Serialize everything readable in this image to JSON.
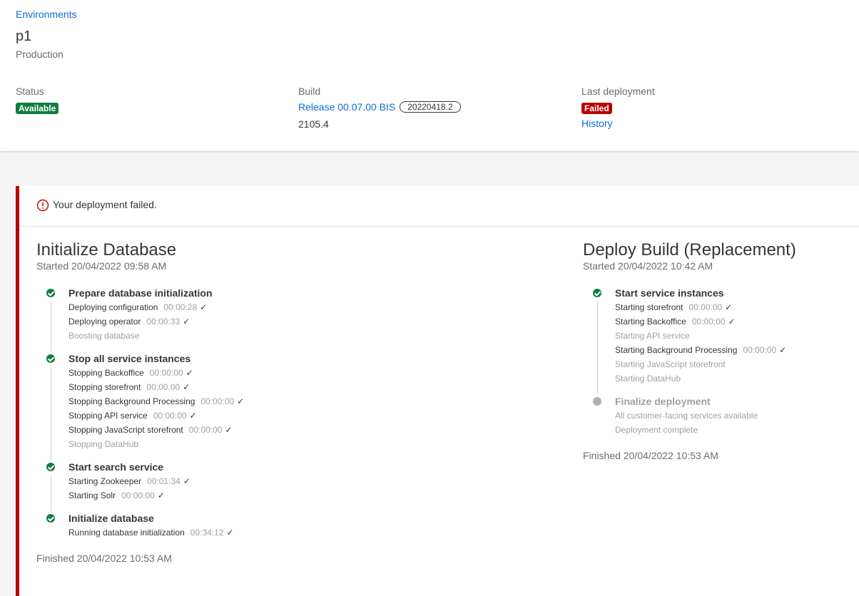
{
  "header": {
    "breadcrumb": "Environments",
    "name": "p1",
    "type": "Production",
    "status_label": "Status",
    "status_value": "Available",
    "build_label": "Build",
    "build_name": "Release 00.07.00 BIS",
    "build_tag": "20220418.2",
    "build_number": "2105.4",
    "last_label": "Last deployment",
    "last_value": "Failed",
    "history_link": "History"
  },
  "alert": {
    "text": "Your deployment failed."
  },
  "stage1": {
    "title": "Initialize Database",
    "started": "Started 20/04/2022 09:58 AM",
    "finished": "Finished 20/04/2022 10:53 AM",
    "steps": [
      {
        "title": "Prepare database initialization",
        "tasks": [
          {
            "name": "Deploying configuration",
            "duration": "00:00:28"
          },
          {
            "name": "Deploying operator",
            "duration": "00:00:33"
          },
          {
            "name": "Boosting database",
            "duration": ""
          }
        ]
      },
      {
        "title": "Stop all service instances",
        "tasks": [
          {
            "name": "Stopping Backoffice",
            "duration": "00:00:00"
          },
          {
            "name": "Stopping storefront",
            "duration": "00:00:00"
          },
          {
            "name": "Stopping Background Processing",
            "duration": "00:00:00"
          },
          {
            "name": "Stopping API service",
            "duration": "00:00:00"
          },
          {
            "name": "Stopping JavaScript storefront",
            "duration": "00:00:00"
          },
          {
            "name": "Stopping DataHub",
            "duration": ""
          }
        ]
      },
      {
        "title": "Start search service",
        "tasks": [
          {
            "name": "Starting Zookeeper",
            "duration": "00:01:34"
          },
          {
            "name": "Starting Solr",
            "duration": "00:00:00"
          }
        ]
      },
      {
        "title": "Initialize database",
        "tasks": [
          {
            "name": "Running database initialization",
            "duration": "00:34:12"
          }
        ]
      }
    ]
  },
  "stage2": {
    "title": "Deploy Build (Replacement)",
    "started": "Started 20/04/2022 10:42 AM",
    "finished": "Finished 20/04/2022 10:53 AM",
    "steps": [
      {
        "title": "Start service instances",
        "tasks": [
          {
            "name": "Starting storefront",
            "duration": "00:00:00"
          },
          {
            "name": "Starting Backoffice",
            "duration": "00:00:00"
          },
          {
            "name": "Starting API service",
            "duration": ""
          },
          {
            "name": "Starting Background Processing",
            "duration": "00:00:00"
          },
          {
            "name": "Starting JavaScript storefront",
            "duration": ""
          },
          {
            "name": "Starting DataHub",
            "duration": ""
          }
        ]
      },
      {
        "title": "Finalize deployment",
        "tasks": [
          {
            "name": "All customer-facing services available",
            "duration": ""
          },
          {
            "name": "Deployment complete",
            "duration": ""
          }
        ]
      }
    ]
  },
  "colors": {
    "accent": "#0a6ed1",
    "success": "#107e3e",
    "error": "#bb0000"
  },
  "icons": {
    "alert": "error-circle-icon",
    "check": "checkmark-icon"
  }
}
